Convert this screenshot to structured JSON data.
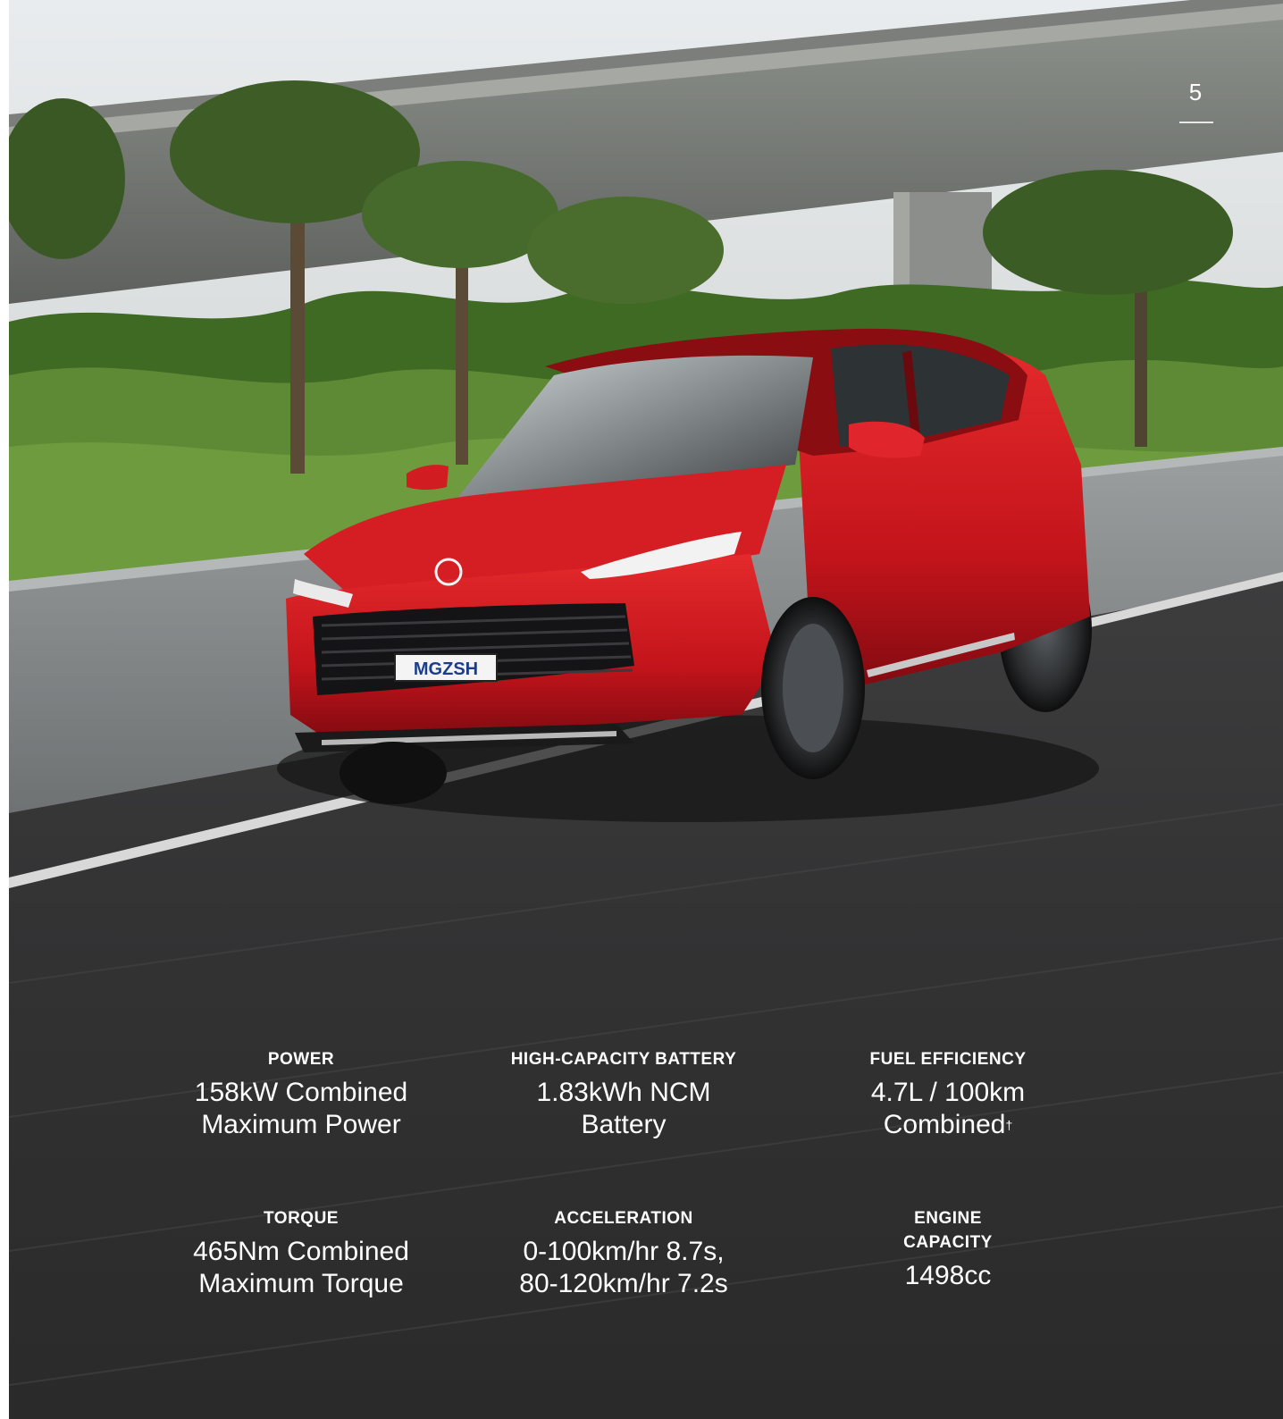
{
  "page_number": "5",
  "photo": {
    "subject": "red-suv-on-highway-icon",
    "plate": "MGZSH"
  },
  "specs": [
    {
      "title": "POWER",
      "value_line1": "158kW Combined",
      "value_line2": "Maximum Power"
    },
    {
      "title": "HIGH-CAPACITY BATTERY",
      "value_line1": "1.83kWh NCM",
      "value_line2": "Battery"
    },
    {
      "title": "FUEL EFFICIENCY",
      "value_line1": "4.7L / 100km",
      "value_line2": "Combined",
      "value_suffix": "†"
    },
    {
      "title": "TORQUE",
      "value_line1": "465Nm Combined",
      "value_line2": "Maximum Torque"
    },
    {
      "title": "ACCELERATION",
      "value_line1": "0-100km/hr 8.7s,",
      "value_line2": "80-120km/hr 7.2s"
    },
    {
      "title": "ENGINE CAPACITY",
      "value_line1": "1498cc",
      "value_line2": ""
    }
  ],
  "colors": {
    "car_red": "#c8141c",
    "road": "#2e2e2e",
    "text": "#ffffff"
  }
}
